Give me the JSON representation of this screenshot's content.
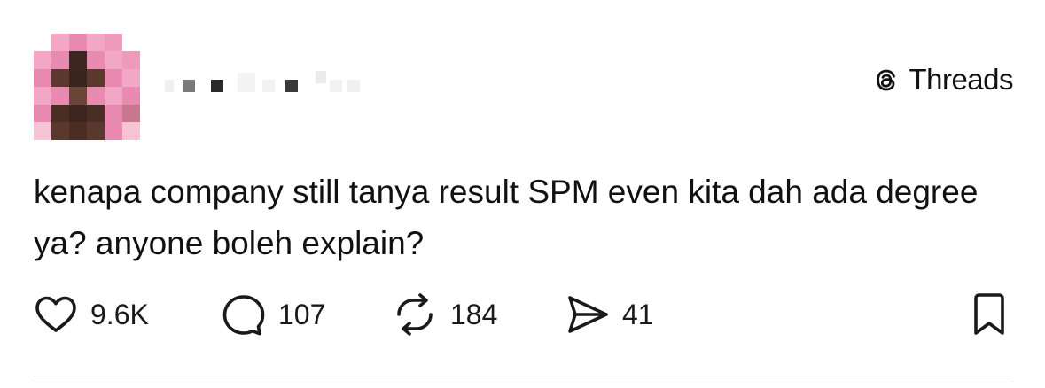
{
  "author": {
    "avatar_pixels": [
      [
        "#ffffff",
        "#f2a8c4",
        "#e98bb0",
        "#f2a8c4",
        "#ee9bbb",
        "#ffffff"
      ],
      [
        "#f2a8c4",
        "#e98bb0",
        "#3d2620",
        "#e98bb0",
        "#f2a8c4",
        "#ee9bbb"
      ],
      [
        "#e98bb0",
        "#5a382e",
        "#3a241e",
        "#5a382e",
        "#e98bb0",
        "#f2a8c4"
      ],
      [
        "#f2a8c4",
        "#e98bb0",
        "#6b4438",
        "#e98bb0",
        "#f2a8c4",
        "#e98bb0"
      ],
      [
        "#e98bb0",
        "#4a2e26",
        "#3d2620",
        "#4a2e26",
        "#e98bb0",
        "#c8778f"
      ],
      [
        "#f7c4d6",
        "#5a382e",
        "#4a2e26",
        "#5a382e",
        "#e98bb0",
        "#f7c4d6"
      ]
    ]
  },
  "brand": {
    "label": "Threads",
    "icon": "threads-logo-icon"
  },
  "post": {
    "text": "kenapa company still tanya result SPM even kita dah ada degree ya? anyone boleh explain?"
  },
  "actions": {
    "like": {
      "icon": "heart-icon",
      "count": "9.6K"
    },
    "reply": {
      "icon": "comment-bubble-icon",
      "count": "107"
    },
    "repost": {
      "icon": "repost-icon",
      "count": "184"
    },
    "share": {
      "icon": "send-icon",
      "count": "41"
    },
    "save": {
      "icon": "bookmark-icon"
    }
  },
  "colors": {
    "text": "#111111",
    "divider": "#e6e6e6",
    "icon": "#1a1a1a"
  }
}
